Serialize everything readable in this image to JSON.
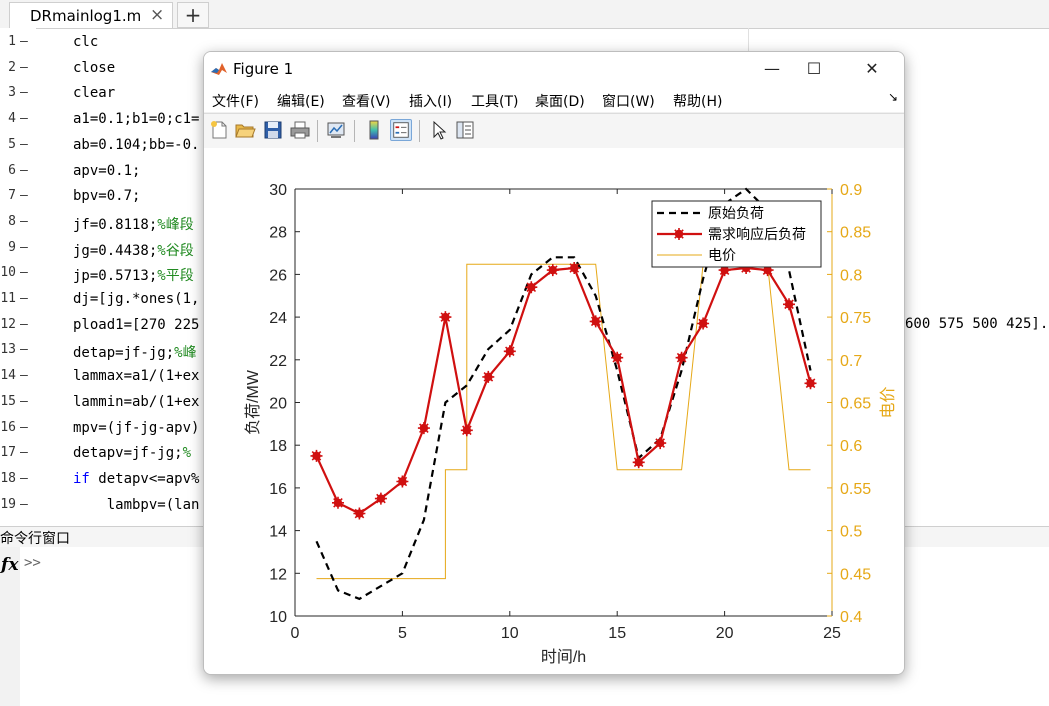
{
  "editor": {
    "tab_label": "DRmainlog1.m",
    "tab_close": "×",
    "tab_add": "+",
    "line_numbers": [
      "1",
      "2",
      "3",
      "4",
      "5",
      "6",
      "7",
      "8",
      "9",
      "10",
      "11",
      "12",
      "13",
      "14",
      "15",
      "16",
      "17",
      "18",
      "19"
    ],
    "line_marker": "—",
    "lines": [
      {
        "code": "clc",
        "comment": ""
      },
      {
        "code": "close",
        "comment": ""
      },
      {
        "code": "clear",
        "comment": ""
      },
      {
        "code": "a1=0.1;b1=0;c1=",
        "comment": ""
      },
      {
        "code": "ab=0.104;bb=-0.",
        "comment": ""
      },
      {
        "code": "apv=0.1;",
        "comment": ""
      },
      {
        "code": "bpv=0.7;",
        "comment": ""
      },
      {
        "code": "jf=0.8118;",
        "comment": "%峰段"
      },
      {
        "code": "jg=0.4438;",
        "comment": "%谷段"
      },
      {
        "code": "jp=0.5713;",
        "comment": "%平段"
      },
      {
        "code": "dj=[jg.*ones(1,",
        "comment": ""
      },
      {
        "code": "pload1=[270 225",
        "comment": ""
      },
      {
        "code": "detap=jf-jg;",
        "comment": "%峰"
      },
      {
        "code": "lammax=a1/(1+ex",
        "comment": ""
      },
      {
        "code": "lammin=ab/(1+ex",
        "comment": ""
      },
      {
        "code": "mpv=(jf-jg-apv)",
        "comment": ""
      },
      {
        "code": "detapv=jf-jg;",
        "comment": "%"
      },
      {
        "code": "if detapv<=apv%",
        "comment": ""
      },
      {
        "code": "    lambpv=(lan",
        "comment": ""
      }
    ],
    "code_tail": "600 575 500 425]."
  },
  "command_window": {
    "title": "命令行窗口",
    "fx": "fx",
    "prompt": ">>"
  },
  "figure": {
    "title": "Figure 1",
    "controls": {
      "minimize": "—",
      "maximize": "☐",
      "close": "✕"
    },
    "menu": [
      "文件(F)",
      "编辑(E)",
      "查看(V)",
      "插入(I)",
      "工具(T)",
      "桌面(D)",
      "窗口(W)",
      "帮助(H)"
    ],
    "menu_arrow": "↘",
    "toolbar_icons": [
      "new-figure-icon",
      "open-file-icon",
      "save-icon",
      "print-icon",
      "link-plot-icon",
      "colorbar-icon",
      "legend-icon",
      "pointer-icon",
      "property-inspector-icon"
    ]
  },
  "chart_data": {
    "type": "line",
    "xlabel": "时间/h",
    "ylabel_left": "负荷/MW",
    "ylabel_right": "电价",
    "xlim": [
      0,
      25
    ],
    "ylim_left": [
      10,
      30
    ],
    "ylim_right": [
      0.4,
      0.9
    ],
    "xticks": [
      "0",
      "5",
      "10",
      "15",
      "20",
      "25"
    ],
    "yticks_left": [
      "10",
      "12",
      "14",
      "16",
      "18",
      "20",
      "22",
      "24",
      "26",
      "28",
      "30"
    ],
    "yticks_right": [
      "0.4",
      "0.45",
      "0.5",
      "0.55",
      "0.6",
      "0.65",
      "0.7",
      "0.75",
      "0.8",
      "0.85",
      "0.9"
    ],
    "legend_position": "top-right",
    "colors": {
      "original": "#000000",
      "dr": "#d01010",
      "price": "#e6a817"
    },
    "series": [
      {
        "name": "原始负荷",
        "style": "dashed",
        "axis": "left",
        "x": [
          1,
          2,
          3,
          4,
          5,
          6,
          7,
          8,
          9,
          10,
          11,
          12,
          13,
          14,
          15,
          16,
          17,
          18,
          19,
          20,
          21,
          22,
          23,
          24
        ],
        "values": [
          13.5,
          11.2,
          10.8,
          11.4,
          12.0,
          14.5,
          20.0,
          20.8,
          22.5,
          23.4,
          26.0,
          26.8,
          26.8,
          25.0,
          21.5,
          17.4,
          18.3,
          21.5,
          25.8,
          29.3,
          30.0,
          29.0,
          26.2,
          21.5
        ]
      },
      {
        "name": "需求响应后负荷",
        "style": "solid-marker",
        "axis": "left",
        "x": [
          1,
          2,
          3,
          4,
          5,
          6,
          7,
          8,
          9,
          10,
          11,
          12,
          13,
          14,
          15,
          16,
          17,
          18,
          19,
          20,
          21,
          22,
          23,
          24
        ],
        "values": [
          17.5,
          15.3,
          14.8,
          15.5,
          16.3,
          18.8,
          24.0,
          18.7,
          21.2,
          22.4,
          25.4,
          26.2,
          26.3,
          23.8,
          22.1,
          17.2,
          18.1,
          22.1,
          23.7,
          26.2,
          26.3,
          26.2,
          24.6,
          20.9
        ]
      },
      {
        "name": "电价",
        "style": "step",
        "axis": "right",
        "x": [
          1,
          7,
          7,
          8,
          8,
          14,
          14,
          15,
          15,
          18,
          18,
          19,
          19,
          22,
          22,
          23,
          23,
          24
        ],
        "values": [
          0.4438,
          0.4438,
          0.5713,
          0.5713,
          0.8118,
          0.8118,
          0.8118,
          0.5713,
          0.5713,
          0.5713,
          0.5713,
          0.8118,
          0.8118,
          0.8118,
          0.8118,
          0.5713,
          0.5713,
          0.5713
        ]
      }
    ]
  }
}
